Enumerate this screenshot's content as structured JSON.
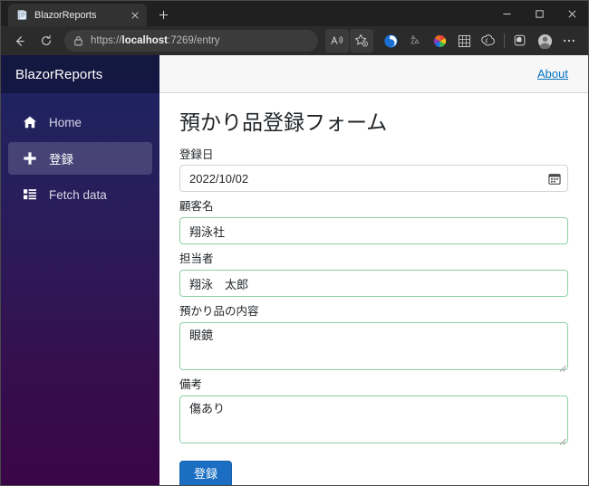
{
  "browser": {
    "tab": {
      "title": "BlazorReports",
      "favicon_icon": "page-favicon",
      "close_icon": "close-icon"
    },
    "new_tab_label": "+",
    "window_controls": {
      "minimize": "–",
      "maximize": "□",
      "close": "✕"
    },
    "nav": {
      "back_icon": "back-arrow-icon",
      "refresh_icon": "refresh-icon"
    },
    "address": {
      "lock_icon": "lock-icon",
      "url_prefix": "https://",
      "url_host": "localhost",
      "url_suffix": ":7269/entry",
      "full_url": "https://localhost:7269/entry"
    },
    "toolbar_icons": [
      "read-aloud-icon",
      "add-to-favorites-icon",
      "browser-essentials-icon",
      "split-screen-icon",
      "colorful-extension-icon",
      "app-grid-icon",
      "copilot-icon",
      "collections-icon",
      "profile-avatar-icon",
      "settings-more-icon"
    ]
  },
  "app": {
    "sidebar": {
      "brand": "BlazorReports",
      "items": [
        {
          "label": "Home",
          "icon": "home-icon",
          "active": false
        },
        {
          "label": "登録",
          "icon": "plus-icon",
          "active": true
        },
        {
          "label": "Fetch data",
          "icon": "list-grid-icon",
          "active": false
        }
      ]
    },
    "topbar": {
      "about_label": "About"
    },
    "form": {
      "title": "預かり品登録フォーム",
      "fields": [
        {
          "name": "registration-date",
          "label": "登録日",
          "value": "2022/10/02",
          "placeholder": "",
          "type": "date",
          "state": "neutral",
          "icon": "calendar-icon"
        },
        {
          "name": "customer-name",
          "label": "顧客名",
          "value": "翔泳社",
          "placeholder": "",
          "type": "text",
          "state": "valid"
        },
        {
          "name": "person-in-charge",
          "label": "担当者",
          "value": "翔泳　太郎",
          "placeholder": "",
          "type": "text",
          "state": "valid"
        },
        {
          "name": "item-contents",
          "label": "預かり品の内容",
          "value": "眼鏡",
          "placeholder": "",
          "type": "textarea",
          "state": "valid"
        },
        {
          "name": "remarks",
          "label": "備考",
          "value": "傷あり",
          "placeholder": "",
          "type": "textarea",
          "state": "valid"
        }
      ],
      "submit_label": "登録"
    }
  },
  "colors": {
    "accent_blue": "#1b6ec2",
    "link_blue": "#0071c1",
    "valid_green": "#8cd2a7",
    "sidebar_top": "#1b2461",
    "sidebar_bottom": "#3a0647",
    "chrome_dark": "#202020"
  }
}
